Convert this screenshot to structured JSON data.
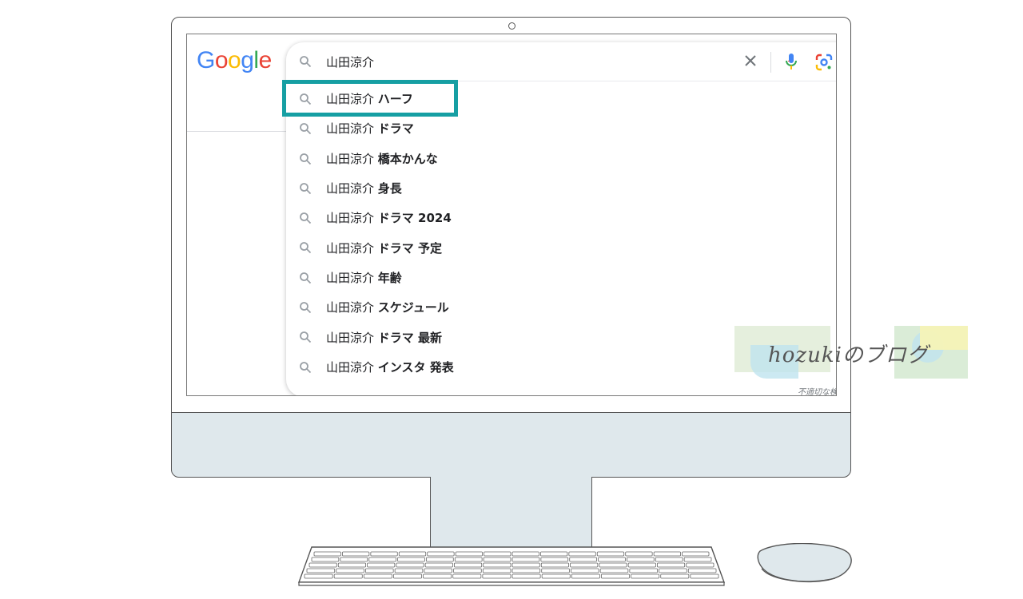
{
  "google": {
    "logo_letters": [
      {
        "ch": "G",
        "color": "#4285F4"
      },
      {
        "ch": "o",
        "color": "#EA4335"
      },
      {
        "ch": "o",
        "color": "#FBBC05"
      },
      {
        "ch": "g",
        "color": "#4285F4"
      },
      {
        "ch": "l",
        "color": "#34A853"
      },
      {
        "ch": "e",
        "color": "#EA4335"
      }
    ]
  },
  "search": {
    "query": "山田涼介",
    "icons": [
      "search-icon",
      "clear-icon",
      "microphone-icon",
      "google-lens-icon"
    ]
  },
  "suggestions": [
    {
      "prefix": "山田涼介 ",
      "suffix": "ハーフ"
    },
    {
      "prefix": "山田涼介 ",
      "suffix": "ドラマ"
    },
    {
      "prefix": "山田涼介 ",
      "suffix": "橋本かんな"
    },
    {
      "prefix": "山田涼介 ",
      "suffix": "身長"
    },
    {
      "prefix": "山田涼介 ",
      "suffix": "ドラマ 2024"
    },
    {
      "prefix": "山田涼介 ",
      "suffix": "ドラマ 予定"
    },
    {
      "prefix": "山田涼介 ",
      "suffix": "年齢"
    },
    {
      "prefix": "山田涼介 ",
      "suffix": "スケジュール"
    },
    {
      "prefix": "山田涼介 ",
      "suffix": "ドラマ 最新"
    },
    {
      "prefix": "山田涼介 ",
      "suffix": "インスタ 発表"
    }
  ],
  "report_link": "不適切な検索候補",
  "highlighted_index": 0,
  "highlight_color": "#169fa3",
  "watermark": "hozukiのブログ"
}
